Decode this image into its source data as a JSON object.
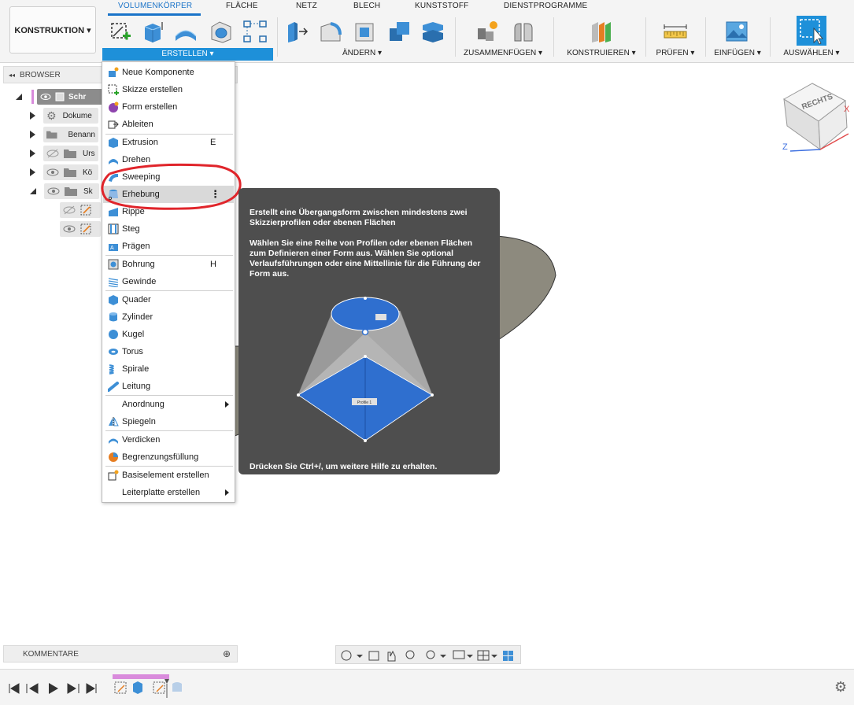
{
  "workspace": {
    "label": "KONSTRUKTION ▾"
  },
  "tabs": [
    {
      "label": "VOLUMENKÖRPER"
    },
    {
      "label": "FLÄCHE"
    },
    {
      "label": "NETZ"
    },
    {
      "label": "BLECH"
    },
    {
      "label": "KUNSTSTOFF"
    },
    {
      "label": "DIENSTPROGRAMME"
    }
  ],
  "groups": {
    "create": "ERSTELLEN ▾",
    "modify": "ÄNDERN ▾",
    "assemble": "ZUSAMMENFÜGEN ▾",
    "construct": "KONSTRUIEREN ▾",
    "inspect": "PRÜFEN ▾",
    "insert": "EINFÜGEN ▾",
    "select": "AUSWÄHLEN ▾"
  },
  "browser": {
    "title": "BROWSER",
    "collapse_glyph": "◂◂",
    "items": [
      {
        "label": "Schr"
      },
      {
        "label": "Dokume"
      },
      {
        "label": "Benann"
      },
      {
        "label": "Urs"
      },
      {
        "label": "Kö"
      },
      {
        "label": "Sk"
      }
    ]
  },
  "menu": {
    "items": [
      {
        "label": "Neue Komponente",
        "shortcut": ""
      },
      {
        "label": "Skizze erstellen",
        "shortcut": ""
      },
      {
        "label": "Form erstellen",
        "shortcut": ""
      },
      {
        "label": "Ableiten",
        "shortcut": ""
      },
      {
        "label": "Extrusion",
        "shortcut": "E"
      },
      {
        "label": "Drehen",
        "shortcut": ""
      },
      {
        "label": "Sweeping",
        "shortcut": ""
      },
      {
        "label": "Erhebung",
        "shortcut": "⋮"
      },
      {
        "label": "Rippe",
        "shortcut": ""
      },
      {
        "label": "Steg",
        "shortcut": ""
      },
      {
        "label": "Prägen",
        "shortcut": ""
      },
      {
        "label": "Bohrung",
        "shortcut": "H"
      },
      {
        "label": "Gewinde",
        "shortcut": ""
      },
      {
        "label": "Quader",
        "shortcut": ""
      },
      {
        "label": "Zylinder",
        "shortcut": ""
      },
      {
        "label": "Kugel",
        "shortcut": ""
      },
      {
        "label": "Torus",
        "shortcut": ""
      },
      {
        "label": "Spirale",
        "shortcut": ""
      },
      {
        "label": "Leitung",
        "shortcut": ""
      },
      {
        "label": "Anordnung",
        "shortcut": ""
      },
      {
        "label": "Spiegeln",
        "shortcut": ""
      },
      {
        "label": "Verdicken",
        "shortcut": ""
      },
      {
        "label": "Begrenzungsfüllung",
        "shortcut": ""
      },
      {
        "label": "Basiselement erstellen",
        "shortcut": ""
      },
      {
        "label": "Leiterplatte erstellen",
        "shortcut": ""
      }
    ]
  },
  "tooltip": {
    "line1": "Erstellt eine Übergangsform zwischen mindestens zwei Skizzierprofilen oder ebenen Flächen",
    "line2": "Wählen Sie eine Reihe von Profilen oder ebenen Flächen zum Definieren einer Form aus. Wählen Sie optional Verlaufsführungen oder eine Mittellinie für die Führung der Form aus.",
    "image_label": "Profile 1",
    "help": "Drücken Sie Ctrl+/, um weitere Hilfe zu erhalten."
  },
  "viewcube": {
    "face": "RECHTS",
    "axis_x": "X",
    "axis_z": "Z"
  },
  "comments": {
    "label": "KOMMENTARE",
    "add_glyph": "⊕"
  },
  "colors": {
    "accent": "#1e90d9",
    "annotation": "#e0252b",
    "tooltip_bg": "#4e4e4e",
    "loft_blue": "#2f6fcf"
  }
}
